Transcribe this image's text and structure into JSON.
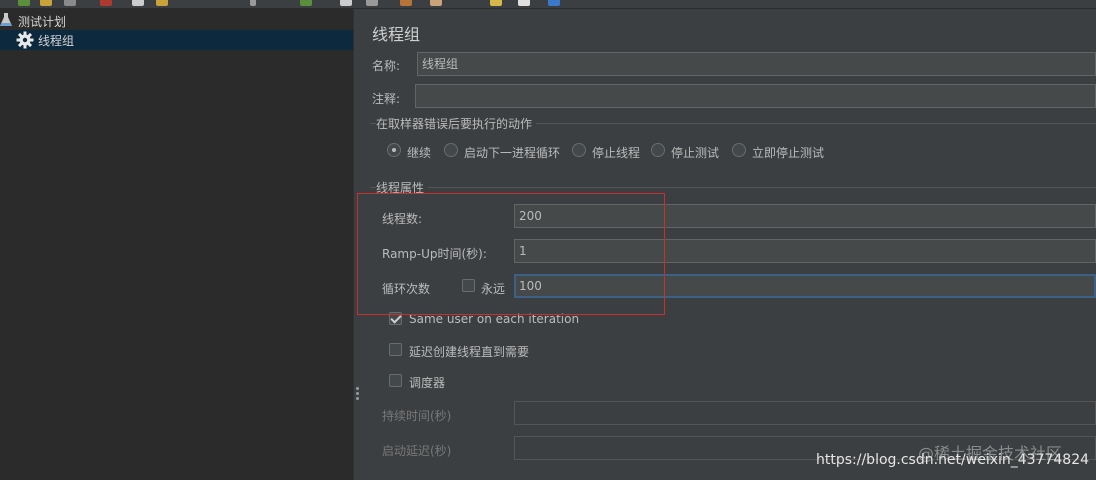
{
  "tree": {
    "plan_label": "测试计划",
    "group_label": "线程组"
  },
  "panel": {
    "title": "线程组",
    "name": {
      "label": "名称:",
      "value": "线程组"
    },
    "comment": {
      "label": "注释:",
      "value": ""
    },
    "error_action": {
      "title": "在取样器错误后要执行的动作",
      "options": [
        {
          "label": "继续",
          "checked": true
        },
        {
          "label": "启动下一进程循环",
          "checked": false
        },
        {
          "label": "停止线程",
          "checked": false
        },
        {
          "label": "停止测试",
          "checked": false
        },
        {
          "label": "立即停止测试",
          "checked": false
        }
      ]
    },
    "thread_props": {
      "title": "线程属性",
      "threads": {
        "label": "线程数:",
        "value": "200"
      },
      "ramp_up": {
        "label": "Ramp-Up时间(秒):",
        "value": "1"
      },
      "loop": {
        "label": "循环次数",
        "forever_label": "永远",
        "forever_checked": false,
        "value": "100"
      },
      "same_user": {
        "label": "Same user on each iteration",
        "checked": true
      },
      "delay_create": {
        "label": "延迟创建线程直到需要",
        "checked": false
      },
      "scheduler": {
        "label": "调度器",
        "checked": false
      },
      "duration": {
        "label": "持续时间(秒)",
        "value": ""
      },
      "startup_delay": {
        "label": "启动延迟(秒)",
        "value": ""
      }
    }
  },
  "watermark": {
    "site": "@稀土掘金技术社区",
    "url": "https://blog.csdn.net/weixin_43774824"
  },
  "colors": {
    "panel_bg": "#3c3f41",
    "tree_bg": "#2b2b2b",
    "selection": "#0d293e",
    "highlight_box": "#c8302d",
    "focus_border": "#3d6185"
  }
}
